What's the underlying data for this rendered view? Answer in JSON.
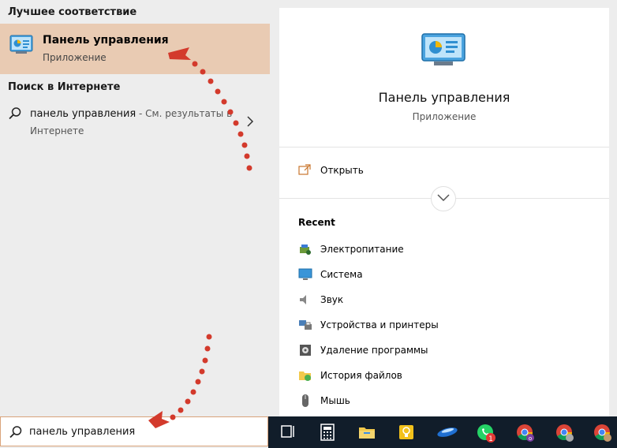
{
  "left": {
    "best_match_heading": "Лучшее соответствие",
    "best_match": {
      "title": "Панель управления",
      "subtitle": "Приложение"
    },
    "web_heading": "Поиск в Интернете",
    "web_result": {
      "query": "панель управления",
      "hint": " - См. результаты в",
      "hint_line2": "Интернете"
    }
  },
  "preview": {
    "title": "Панель управления",
    "subtitle": "Приложение",
    "open_label": "Открыть",
    "recent_heading": "Recent",
    "recent_items": [
      {
        "label": "Электропитание",
        "icon": "power-options-icon"
      },
      {
        "label": "Система",
        "icon": "system-icon"
      },
      {
        "label": "Звук",
        "icon": "sound-icon"
      },
      {
        "label": "Устройства и принтеры",
        "icon": "devices-printers-icon"
      },
      {
        "label": "Удаление программы",
        "icon": "uninstall-program-icon"
      },
      {
        "label": "История файлов",
        "icon": "file-history-icon"
      },
      {
        "label": "Мышь",
        "icon": "mouse-icon"
      }
    ]
  },
  "search": {
    "value": "панель управления"
  },
  "taskbar": {
    "icons": [
      "task-view-icon",
      "calculator-icon",
      "file-explorer-icon",
      "tips-icon",
      "app-icon",
      "whatsapp-icon",
      "chrome-icon",
      "chrome-icon",
      "chrome-icon"
    ],
    "badges": {
      "whatsapp": "1"
    }
  },
  "colors": {
    "highlight": "#e9cbb3",
    "taskbar": "#111d2a",
    "annotation": "#d33a2c"
  }
}
